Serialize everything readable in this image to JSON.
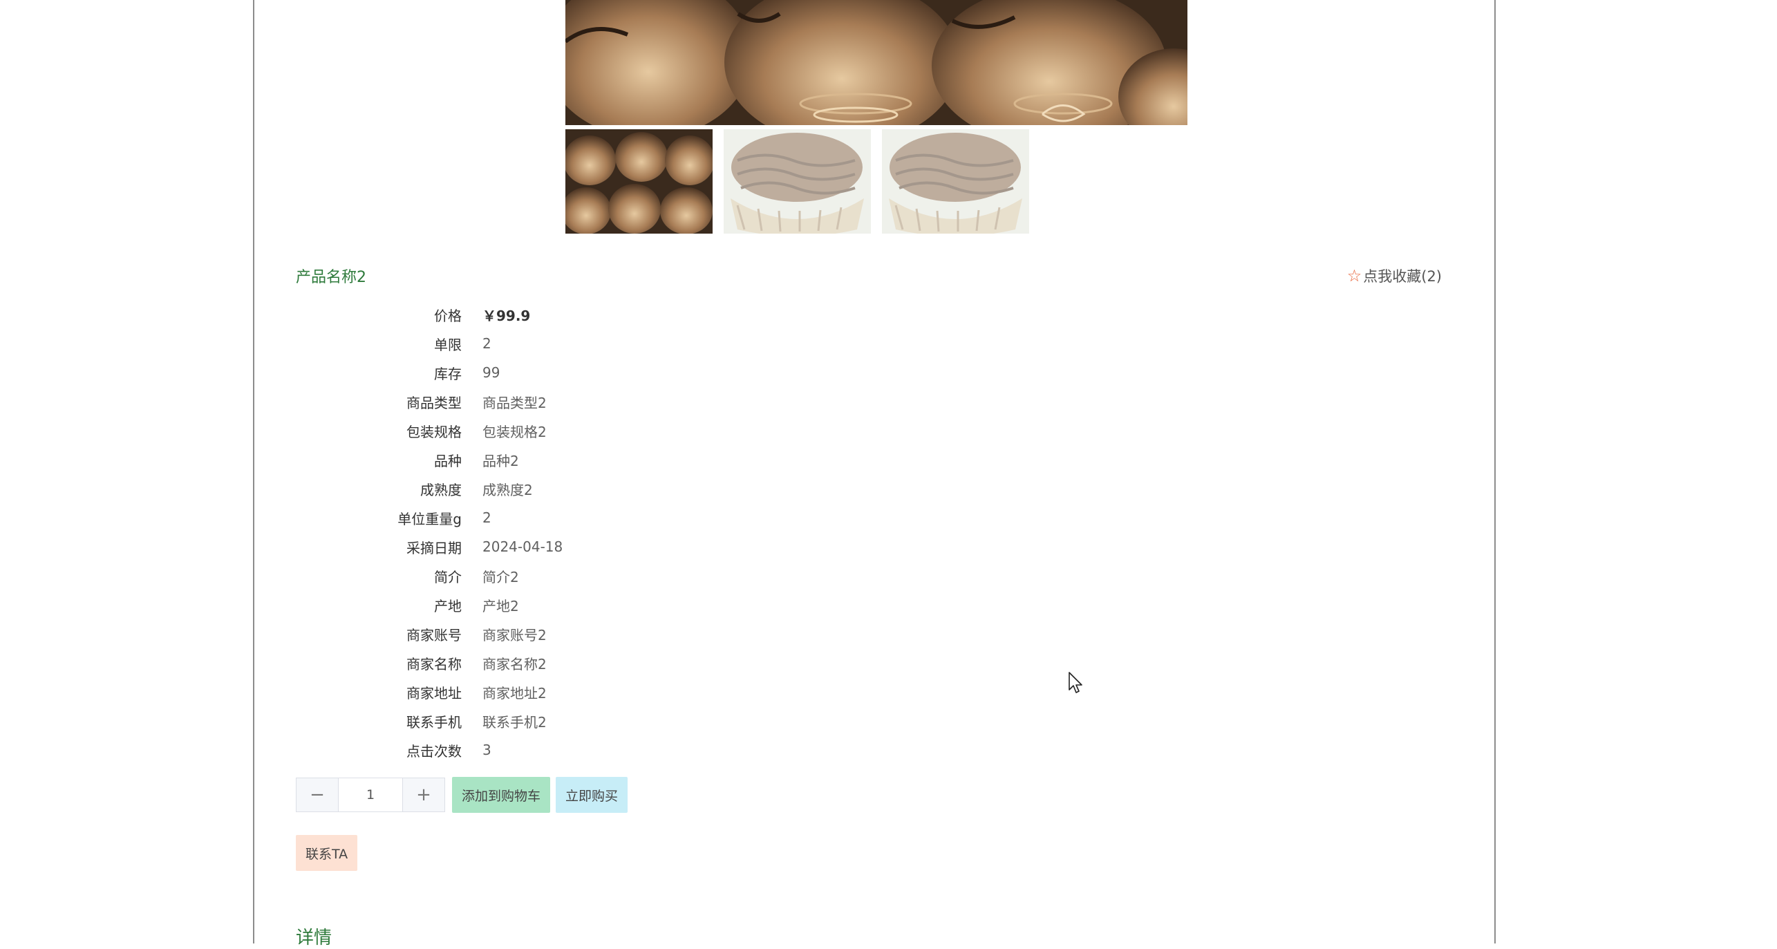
{
  "product": {
    "title": "产品名称2",
    "favorite_label": "点我收藏(2)"
  },
  "info": [
    {
      "label": "价格",
      "value": "￥99.9"
    },
    {
      "label": "单限",
      "value": "2"
    },
    {
      "label": "库存",
      "value": "99"
    },
    {
      "label": "商品类型",
      "value": "商品类型2"
    },
    {
      "label": "包装规格",
      "value": "包装规格2"
    },
    {
      "label": "品种",
      "value": "品种2"
    },
    {
      "label": "成熟度",
      "value": "成熟度2"
    },
    {
      "label": "单位重量g",
      "value": "2"
    },
    {
      "label": "采摘日期",
      "value": "2024-04-18"
    },
    {
      "label": "简介",
      "value": "简介2"
    },
    {
      "label": "产地",
      "value": "产地2"
    },
    {
      "label": "商家账号",
      "value": "商家账号2"
    },
    {
      "label": "商家名称",
      "value": "商家名称2"
    },
    {
      "label": "商家地址",
      "value": "商家地址2"
    },
    {
      "label": "联系手机",
      "value": "联系手机2"
    },
    {
      "label": "点击次数",
      "value": "3"
    }
  ],
  "actions": {
    "quantity": "1",
    "minus_symbol": "−",
    "plus_symbol": "+",
    "add_to_cart": "添加到购物车",
    "buy_now": "立即购买",
    "contact": "联系TA"
  },
  "sections": {
    "details": "详情"
  },
  "icons": {
    "favorite": "star-outline-icon",
    "minus": "minus-icon",
    "plus": "plus-icon",
    "cursor": "mouse-pointer-icon"
  },
  "colors": {
    "title_green": "#2e7a3b",
    "star_orange": "#e8663d",
    "cart_button": "#a9e4c4",
    "buy_button": "#c7edf7",
    "contact_button": "#fde1d3"
  }
}
